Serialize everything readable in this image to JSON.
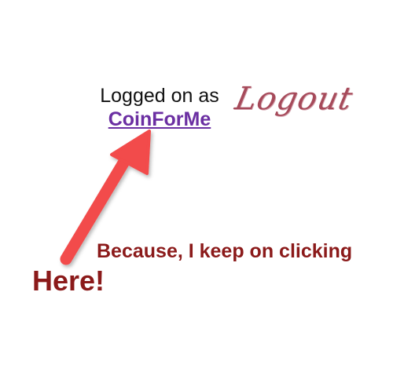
{
  "login": {
    "status_text": "Logged on as",
    "username": "CoinForMe",
    "logout_label": "Logout"
  },
  "annotation": {
    "line1": "Because, I keep on clicking",
    "line2": "Here!"
  },
  "colors": {
    "username": "#6b2fa2",
    "logout": "#a64a5a",
    "annotation_text": "#8b1a1a",
    "arrow": "#f24b4b"
  },
  "icons": {
    "arrow": "annotation-arrow-icon"
  }
}
